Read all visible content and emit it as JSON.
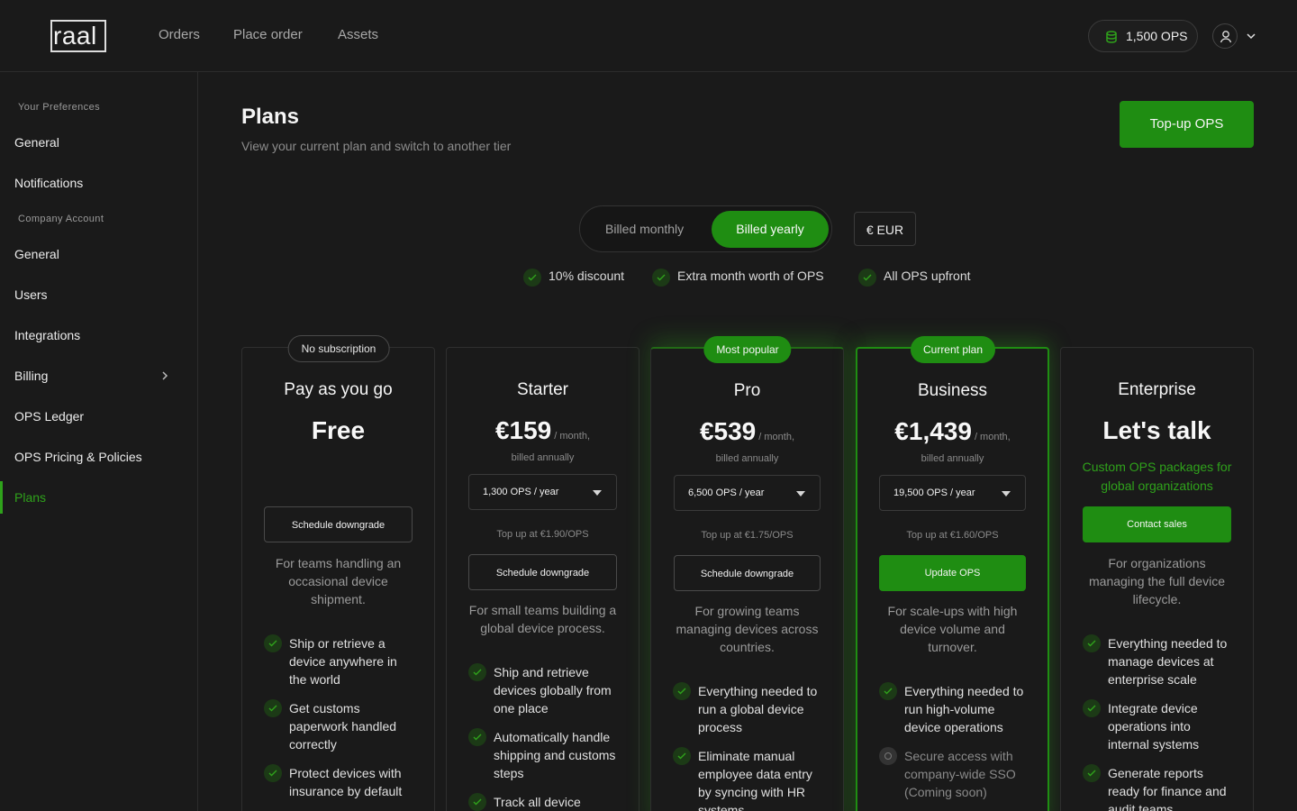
{
  "brand": {
    "logo_text": "raal"
  },
  "nav": {
    "items": [
      "Orders",
      "Place order",
      "Assets"
    ]
  },
  "header": {
    "ops_balance": "1,500 OPS"
  },
  "sidebar": {
    "group1": "Your Preferences",
    "group2": "Company Account",
    "items": [
      "General",
      "Notifications",
      "General",
      "Users",
      "Integrations",
      "Billing",
      "OPS Ledger",
      "OPS Pricing & Policies",
      "Plans"
    ],
    "active": "Plans"
  },
  "page": {
    "title": "Plans",
    "subtitle": "View your current plan and switch to another tier",
    "topup_label": "Top-up OPS"
  },
  "billing": {
    "monthly_label": "Billed monthly",
    "yearly_label": "Billed yearly",
    "selected": "yearly",
    "currency": "€ EUR",
    "benefits": [
      "10% discount",
      "Extra month worth of OPS",
      "All OPS upfront"
    ]
  },
  "plans": [
    {
      "tag": "No subscription",
      "name": "Pay as you go",
      "price": "Free",
      "button": "Schedule downgrade",
      "description": "For teams handling an occasional device shipment.",
      "features": [
        "Ship or retrieve a device anywhere in the world",
        "Get customs paperwork handled correctly",
        "Protect devices with insurance by default"
      ]
    },
    {
      "tag": "",
      "name": "Starter",
      "price": "€159",
      "period": "/ month,",
      "billed": "billed annually",
      "ops_option": "1,300 OPS / year",
      "topup_rate": "Top up at €1.90/OPS",
      "button": "Schedule downgrade",
      "description": "For small teams building a global device process.",
      "features": [
        "Ship and retrieve devices globally from one place",
        "Automatically handle shipping and customs steps",
        "Track all device"
      ]
    },
    {
      "tag": "Most popular",
      "name": "Pro",
      "price": "€539",
      "period": "/ month,",
      "billed": "billed annually",
      "ops_option": "6,500 OPS / year",
      "topup_rate": "Top up at €1.75/OPS",
      "button": "Schedule downgrade",
      "description": "For growing teams managing devices across countries.",
      "features": [
        "Everything needed to run a global device process",
        "Eliminate manual employee data entry by syncing with HR systems"
      ]
    },
    {
      "tag": "Current plan",
      "name": "Business",
      "price": "€1,439",
      "period": "/ month,",
      "billed": "billed annually",
      "ops_option": "19,500 OPS / year",
      "topup_rate": "Top up at €1.60/OPS",
      "button": "Update OPS",
      "description": "For scale-ups with high device volume and turnover.",
      "features": [
        "Everything needed to run high-volume device operations",
        "Secure access with company-wide SSO (Coming soon)"
      ]
    },
    {
      "tag": "",
      "name": "Enterprise",
      "price": "Let's talk",
      "note": "Custom OPS packages for global organizations",
      "button": "Contact sales",
      "description": "For organizations managing the full device lifecycle.",
      "features": [
        "Everything needed to manage devices at enterprise scale",
        "Integrate device operations into internal systems",
        "Generate reports ready for finance and audit teams"
      ]
    }
  ],
  "colors": {
    "accent": "#1f8d12",
    "accent_text": "#2fa21b",
    "background": "#1a1a1a"
  }
}
